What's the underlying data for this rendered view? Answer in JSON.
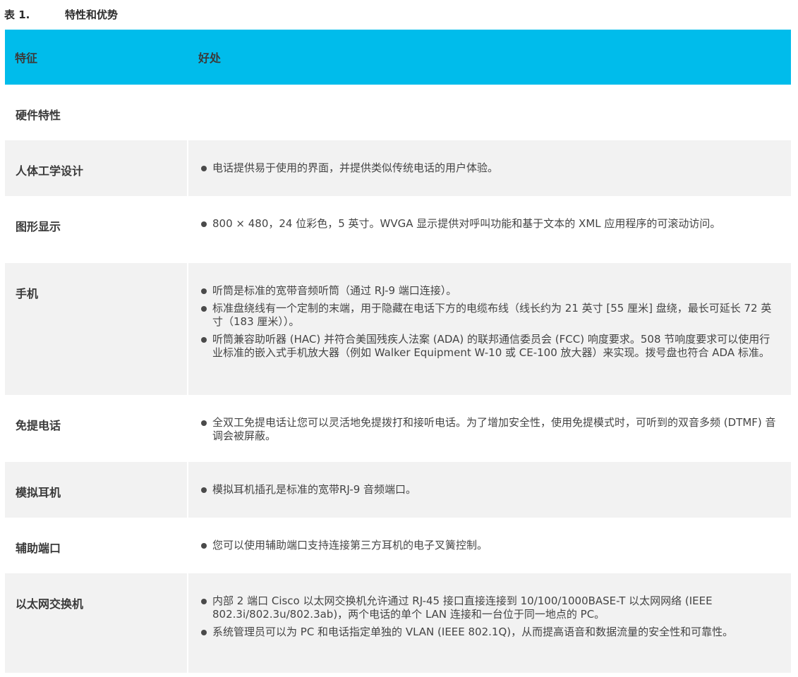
{
  "caption": {
    "number": "表 1.",
    "title": "特性和优势"
  },
  "header": {
    "feature": "特征",
    "benefit": "好处"
  },
  "rows": [
    {
      "feature": "硬件特性",
      "benefits": []
    },
    {
      "feature": "人体工学设计",
      "benefits": [
        "电话提供易于使用的界面，并提供类似传统电话的用户体验。"
      ]
    },
    {
      "feature": "图形显示",
      "benefits": [
        "800 × 480，24 位彩色，5 英寸。WVGA 显示提供对呼叫功能和基于文本的 XML 应用程序的可滚动访问。"
      ]
    },
    {
      "feature": "手机",
      "benefits": [
        "听筒是标准的宽带音频听筒（通过 RJ-9 端口连接）。",
        "标准盘绕线有一个定制的末端，用于隐藏在电话下方的电缆布线（线长约为 21 英寸 [55 厘米] 盘绕，最长可延长 72 英寸（183 厘米））。",
        "听筒兼容助听器 (HAC) 并符合美国残疾人法案 (ADA) 的联邦通信委员会 (FCC) 响度要求。508 节响度要求可以使用行业标准的嵌入式手机放大器（例如 Walker Equipment W-10 或 CE-100 放大器）来实现。拨号盘也符合 ADA 标准。"
      ]
    },
    {
      "feature": "免提电话",
      "benefits": [
        "全双工免提电话让您可以灵活地免提拨打和接听电话。为了增加安全性，使用免提模式时，可听到的双音多频 (DTMF) 音调会被屏蔽。"
      ]
    },
    {
      "feature": "模拟耳机",
      "benefits": [
        "模拟耳机插孔是标准的宽带RJ-9 音频端口。"
      ]
    },
    {
      "feature": "辅助端口",
      "benefits": [
        "您可以使用辅助端口支持连接第三方耳机的电子叉簧控制。"
      ]
    },
    {
      "feature": "以太网交换机",
      "benefits": [
        "内部 2 端口 Cisco 以太网交换机允许通过 RJ-45 接口直接连接到 10/100/1000BASE-T 以太网网络 (IEEE 802.3i/802.3u/802.3ab)，两个电话的单个 LAN 连接和一台位于同一地点的 PC。",
        "系统管理员可以为 PC 和电话指定单独的 VLAN (IEEE 802.1Q)，从而提高语音和数据流量的安全性和可靠性。"
      ]
    }
  ]
}
